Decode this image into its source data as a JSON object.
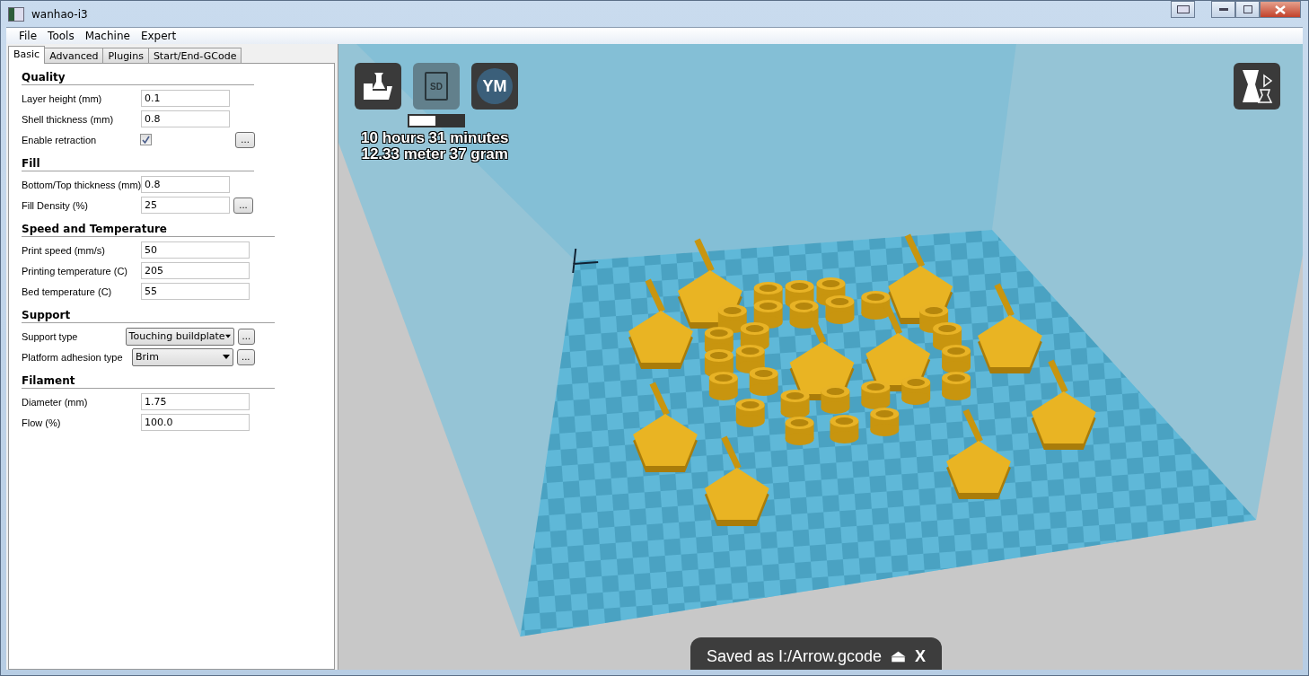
{
  "window": {
    "title": "wanhao-i3"
  },
  "menu": [
    {
      "label": "File"
    },
    {
      "label": "Tools"
    },
    {
      "label": "Machine"
    },
    {
      "label": "Expert"
    }
  ],
  "tabs": [
    {
      "label": "Basic",
      "selected": true
    },
    {
      "label": "Advanced",
      "selected": false
    },
    {
      "label": "Plugins",
      "selected": false
    },
    {
      "label": "Start/End-GCode",
      "selected": false
    }
  ],
  "sections": [
    {
      "title": "Quality",
      "rows": [
        {
          "kind": "field",
          "label": "Layer height (mm)",
          "value": "0.1",
          "more": false
        },
        {
          "kind": "field",
          "label": "Shell thickness (mm)",
          "value": "0.8",
          "more": false
        },
        {
          "kind": "checkbox",
          "label": "Enable retraction",
          "checked": true,
          "more": true
        }
      ]
    },
    {
      "title": "Fill",
      "rows": [
        {
          "kind": "field",
          "label": "Bottom/Top thickness (mm)",
          "value": "0.8",
          "more": false
        },
        {
          "kind": "field",
          "label": "Fill Density (%)",
          "value": "25",
          "more": true
        }
      ]
    },
    {
      "title": "Speed and Temperature",
      "rows": [
        {
          "kind": "field",
          "label": "Print speed (mm/s)",
          "value": "50",
          "more": false
        },
        {
          "kind": "field",
          "label": "Printing temperature (C)",
          "value": "205",
          "more": false
        },
        {
          "kind": "field",
          "label": "Bed temperature (C)",
          "value": "55",
          "more": false
        }
      ]
    },
    {
      "title": "Support",
      "rows": [
        {
          "kind": "select",
          "label": "Support type",
          "value": "Touching buildplate",
          "more": true
        },
        {
          "kind": "select",
          "label": "Platform adhesion type",
          "value": "Brim",
          "more": true
        }
      ]
    },
    {
      "title": "Filament",
      "rows": [
        {
          "kind": "field",
          "label": "Diameter (mm)",
          "value": "1.75",
          "more": false
        },
        {
          "kind": "field",
          "label": "Flow (%)",
          "value": "100.0",
          "more": false
        }
      ]
    }
  ],
  "more_button": "...",
  "toolbar": [
    {
      "kind": "load",
      "disabled": false
    },
    {
      "kind": "sd",
      "label": "SD",
      "disabled": true
    },
    {
      "kind": "ym",
      "label": "YM",
      "disabled": false
    }
  ],
  "progress": {
    "level": 0.48
  },
  "stats": [
    "10 hours 31 minutes",
    "12.33 meter 37 gram"
  ],
  "notification": {
    "text": "Saved as I:/Arrow.gcode",
    "eject": "⏏",
    "close": "X"
  }
}
